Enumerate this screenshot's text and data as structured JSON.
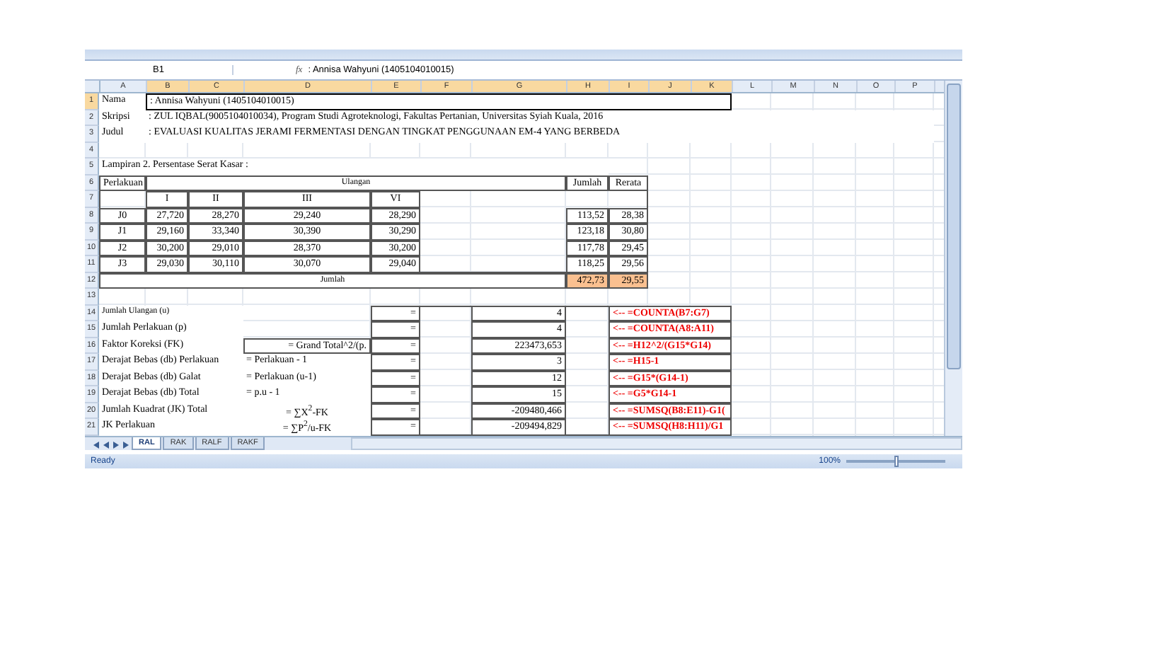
{
  "formula_bar": {
    "name_box": "B1",
    "fx": "fx",
    "content": ": Annisa Wahyuni (1405104010015)"
  },
  "columns": [
    {
      "label": "A",
      "selected": false
    },
    {
      "label": "B",
      "selected": true
    },
    {
      "label": "C",
      "selected": true
    },
    {
      "label": "D",
      "selected": true
    },
    {
      "label": "E",
      "selected": true
    },
    {
      "label": "F",
      "selected": true
    },
    {
      "label": "G",
      "selected": true
    },
    {
      "label": "H",
      "selected": true
    },
    {
      "label": "I",
      "selected": true
    },
    {
      "label": "J",
      "selected": true
    },
    {
      "label": "K",
      "selected": true
    },
    {
      "label": "L",
      "selected": false
    },
    {
      "label": "M",
      "selected": false
    },
    {
      "label": "N",
      "selected": false
    },
    {
      "label": "O",
      "selected": false
    },
    {
      "label": "P",
      "selected": false
    }
  ],
  "row_headers": [
    {
      "label": "1",
      "selected": true
    },
    {
      "label": "2",
      "selected": false
    },
    {
      "label": "3",
      "selected": false
    },
    {
      "label": "4",
      "selected": false
    },
    {
      "label": "5",
      "selected": false
    },
    {
      "label": "6",
      "selected": false
    },
    {
      "label": "7",
      "selected": false
    },
    {
      "label": "8",
      "selected": false
    },
    {
      "label": "9",
      "selected": false
    },
    {
      "label": "10",
      "selected": false
    },
    {
      "label": "11",
      "selected": false
    },
    {
      "label": "12",
      "selected": false
    },
    {
      "label": "13",
      "selected": false
    },
    {
      "label": "14",
      "selected": false
    },
    {
      "label": "15",
      "selected": false
    },
    {
      "label": "16",
      "selected": false
    },
    {
      "label": "17",
      "selected": false
    },
    {
      "label": "18",
      "selected": false
    },
    {
      "label": "19",
      "selected": false
    },
    {
      "label": "20",
      "selected": false
    },
    {
      "label": "21",
      "selected": false
    }
  ],
  "info": [
    {
      "label": "Nama",
      "value": ": Annisa Wahyuni (1405104010015)",
      "selected": true
    },
    {
      "label": "Skripsi",
      "value": ": ZUL IQBAL(9005104010034), Program Studi Agroteknologi, Fakultas Pertanian, Universitas Syiah Kuala, 2016",
      "selected": false
    },
    {
      "label": "Judul",
      "value": ": EVALUASI KUALITAS  JERAMI FERMENTASI DENGAN TINGKAT PENGGUNAAN EM-4 YANG BERBEDA",
      "selected": false
    }
  ],
  "caption": "Lampiran 2. Persentase Serat Kasar :",
  "data_table": {
    "treatment_header": "Perlakuan",
    "replicates_header": "Ulangan",
    "replicate_labels": [
      "I",
      "II",
      "III",
      "VI"
    ],
    "total_header": "Jumlah",
    "mean_header": "Rerata",
    "rows": [
      {
        "treatment": "J0",
        "values": [
          "27,720",
          "28,270",
          "29,240",
          "28,290"
        ],
        "total": "113,52",
        "mean": "28,38"
      },
      {
        "treatment": "J1",
        "values": [
          "29,160",
          "33,340",
          "30,390",
          "30,290"
        ],
        "total": "123,18",
        "mean": "30,80"
      },
      {
        "treatment": "J2",
        "values": [
          "30,200",
          "29,010",
          "28,370",
          "30,200"
        ],
        "total": "117,78",
        "mean": "29,45"
      },
      {
        "treatment": "J3",
        "values": [
          "29,030",
          "30,110",
          "30,070",
          "29,040"
        ],
        "total": "118,25",
        "mean": "29,56"
      }
    ],
    "sum": {
      "label": "Jumlah",
      "total": "472,73",
      "mean": "29,55"
    }
  },
  "stats": [
    {
      "label": "Jumlah Ulangan (u)",
      "equals": "=",
      "value": "4",
      "formula": "<-- =COUNTA(B7:G7)"
    },
    {
      "label": "Jumlah Perlakuan (p)",
      "equals": "=",
      "value": "4",
      "formula": "<-- =COUNTA(A8:A11)"
    },
    {
      "label": "Faktor Koreksi (FK)",
      "expression": "= Grand Total^2/(p.",
      "equals": "=",
      "value": "223473,653",
      "formula": "<-- =H12^2/(G15*G14)"
    },
    {
      "label": "Derajat Bebas (db) Perlakuan",
      "expression": "= Perlakuan - 1",
      "equals": "=",
      "value": "3",
      "formula": "<-- =H15-1"
    },
    {
      "label": "Derajat Bebas (db) Galat",
      "expression": "= Perlakuan (u-1)",
      "equals": "=",
      "value": "12",
      "formula": "<-- =G15*(G14-1)"
    },
    {
      "label": "Derajat Bebas (db) Total",
      "expression": "= p.u - 1",
      "equals": "=",
      "value": "15",
      "formula": "<-- =G5*G14-1"
    },
    {
      "label": "Jumlah Kuadrat (JK) Total",
      "expression": "= ∑X$^{2}$-FK",
      "equals": "=",
      "value": "-209480,466",
      "formula": "<-- =SUMSQ(B8:E11)-G1("
    },
    {
      "label": "JK Perlakuan",
      "expression": "= ∑P$^{2}$/u-FK",
      "equals": "=",
      "value": "-209494,829",
      "formula": "<-- =SUMSQ(H8:H11)/G1"
    }
  ],
  "sheet_tabs": [
    {
      "label": "RAL",
      "selected": true
    },
    {
      "label": "RAK",
      "selected": false
    },
    {
      "label": "RALF",
      "selected": false
    },
    {
      "label": "RAKF",
      "selected": false
    }
  ],
  "status_bar": {
    "text": "Ready",
    "zoom": "100%",
    "zoom_slider": {
      "level": 0.5
    }
  }
}
